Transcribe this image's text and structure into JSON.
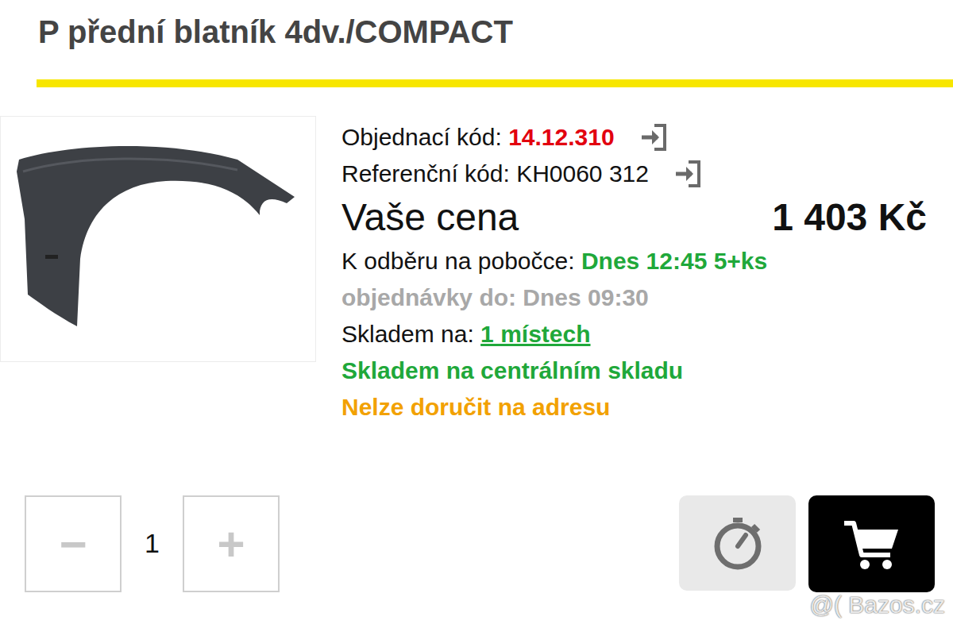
{
  "title": "P přední blatník 4dv./COMPACT",
  "product": {
    "order_code": {
      "label": "Objednací kód:",
      "value": "14.12.310"
    },
    "reference_code": {
      "label": "Referenční kód:",
      "value": "KH0060 312"
    },
    "price": {
      "label": "Vaše cena",
      "value": "1 403 Kč"
    },
    "pickup": {
      "label": "K odběru na pobočce:",
      "value": "Dnes 12:45 5+ks"
    },
    "order_deadline": "objednávky do: Dnes 09:30",
    "stock": {
      "label": "Skladem na:",
      "value": "1 místech"
    },
    "central_stock": "Skladem na centrálním skladu",
    "delivery": "Nelze doručit na adresu"
  },
  "quantity": {
    "minus": "−",
    "value": "1",
    "plus": "+"
  },
  "watermark": "@( Bazos.cz"
}
